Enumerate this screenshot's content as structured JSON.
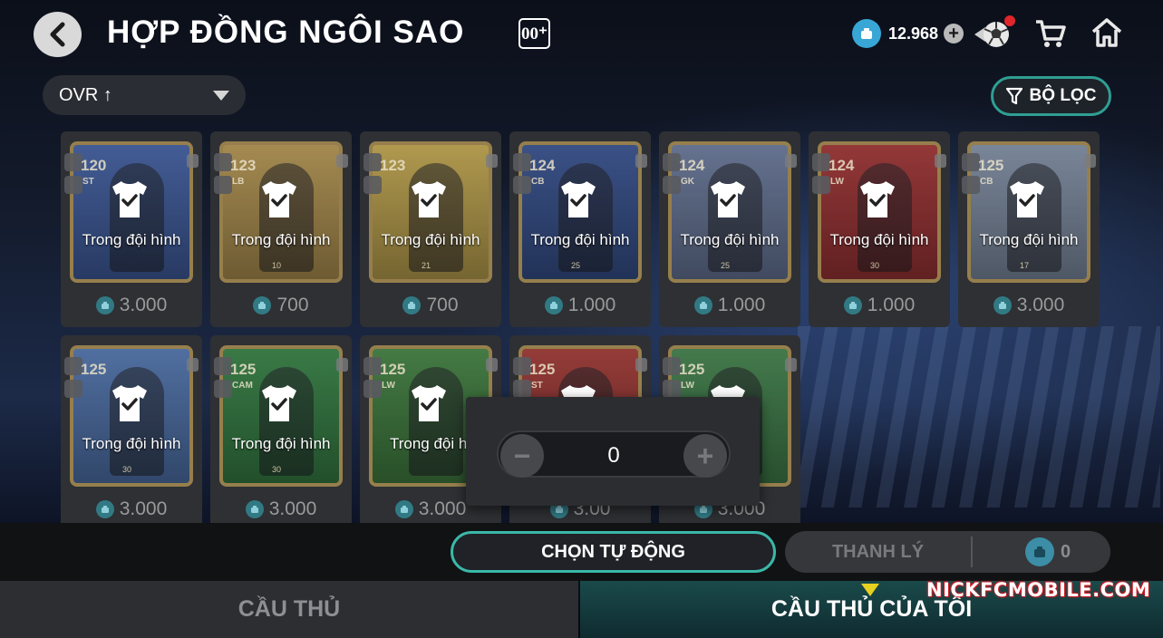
{
  "header": {
    "title": "HỢP ĐỒNG NGÔI SAO",
    "badge": "00⁺",
    "coin_balance": "12.968",
    "icons": [
      "back-icon",
      "coin-icon",
      "plus-icon",
      "soccer-ball-icon",
      "cart-icon",
      "home-icon"
    ]
  },
  "sort": {
    "label": "OVR ↑"
  },
  "filter": {
    "label": "BỘ LỌC"
  },
  "cards": [
    {
      "ovr": "120",
      "pos": "ST",
      "level": "",
      "status": "Trong đội hình",
      "price": "3.000",
      "color": "#3b5fb0"
    },
    {
      "ovr": "123",
      "pos": "LB",
      "level": "10",
      "status": "Trong đội hình",
      "price": "700",
      "color": "#c9a24e"
    },
    {
      "ovr": "123",
      "pos": "",
      "level": "21",
      "status": "Trong đội hình",
      "price": "700",
      "color": "#d9b74a"
    },
    {
      "ovr": "124",
      "pos": "CB",
      "level": "25",
      "status": "Trong đội hình",
      "price": "1.000",
      "color": "#2f4f9a"
    },
    {
      "ovr": "124",
      "pos": "GK",
      "level": "25",
      "status": "Trong đội hình",
      "price": "1.000",
      "color": "#6d7fa8"
    },
    {
      "ovr": "124",
      "pos": "LW",
      "level": "30",
      "status": "Trong đội hình",
      "price": "1.000",
      "color": "#b02a2a"
    },
    {
      "ovr": "125",
      "pos": "CB",
      "level": "17",
      "status": "Trong đội hình",
      "price": "3.000",
      "color": "#8a9bb5"
    },
    {
      "ovr": "125",
      "pos": "",
      "level": "30",
      "status": "Trong đội hình",
      "price": "3.000",
      "color": "#4e7ac0"
    },
    {
      "ovr": "125",
      "pos": "CAM",
      "level": "30",
      "status": "Trong đội hình",
      "price": "3.000",
      "color": "#2e8a3e"
    },
    {
      "ovr": "125",
      "pos": "LW",
      "level": "",
      "status": "Trong đội hì",
      "price": "3.000",
      "color": "#3d8a3a"
    },
    {
      "ovr": "125",
      "pos": "ST",
      "level": "",
      "status": "",
      "price": "3.00",
      "color": "#b0302a"
    },
    {
      "ovr": "125",
      "pos": "LW",
      "level": "",
      "status": "",
      "price": "3.000",
      "color": "#3c8a46"
    }
  ],
  "stepper": {
    "value": "0",
    "minus": "−",
    "plus": "+"
  },
  "actions": {
    "auto_select": "CHỌN TỰ ĐỘNG",
    "sell": "THANH LÝ",
    "sell_count": "0"
  },
  "tabs": {
    "players": "CẦU THỦ",
    "my_players": "CẦU THỦ CỦA TÔI"
  },
  "watermark": "NICKFCMOBILE.COM",
  "colors": {
    "accent": "#3ab8a8",
    "coin": "#38a7d6",
    "tab_active": "#1a4a4a",
    "marker": "#e8d020"
  }
}
